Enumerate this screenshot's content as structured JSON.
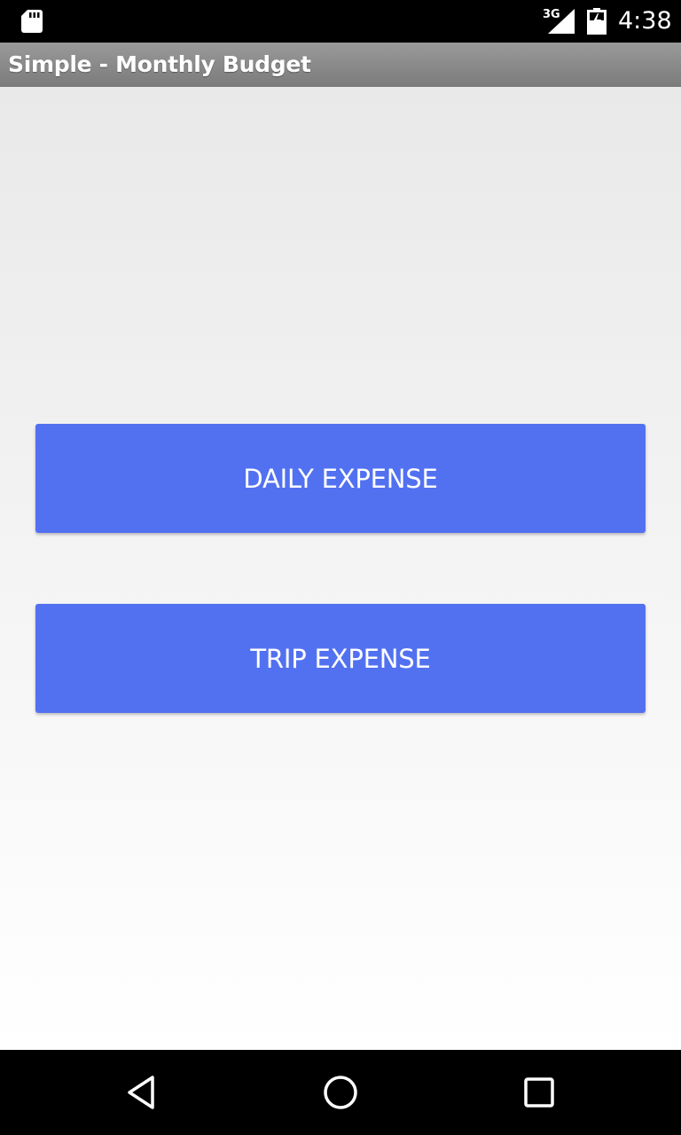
{
  "status_bar": {
    "network": "3G",
    "time": "4:38",
    "icons": [
      "sd-card-icon",
      "signal-icon",
      "battery-charging-icon"
    ]
  },
  "action_bar": {
    "title": "Simple - Monthly Budget"
  },
  "main": {
    "buttons": [
      {
        "label": "DAILY EXPENSE"
      },
      {
        "label": "TRIP EXPENSE"
      }
    ]
  },
  "nav_bar": {
    "icons": [
      "back-icon",
      "home-icon",
      "recent-apps-icon"
    ]
  },
  "colors": {
    "button": "#5271f1",
    "status_bar": "#000000",
    "action_bar": "#8a8a8a",
    "background_top": "#e9e9e9",
    "background_bottom": "#ffffff"
  }
}
